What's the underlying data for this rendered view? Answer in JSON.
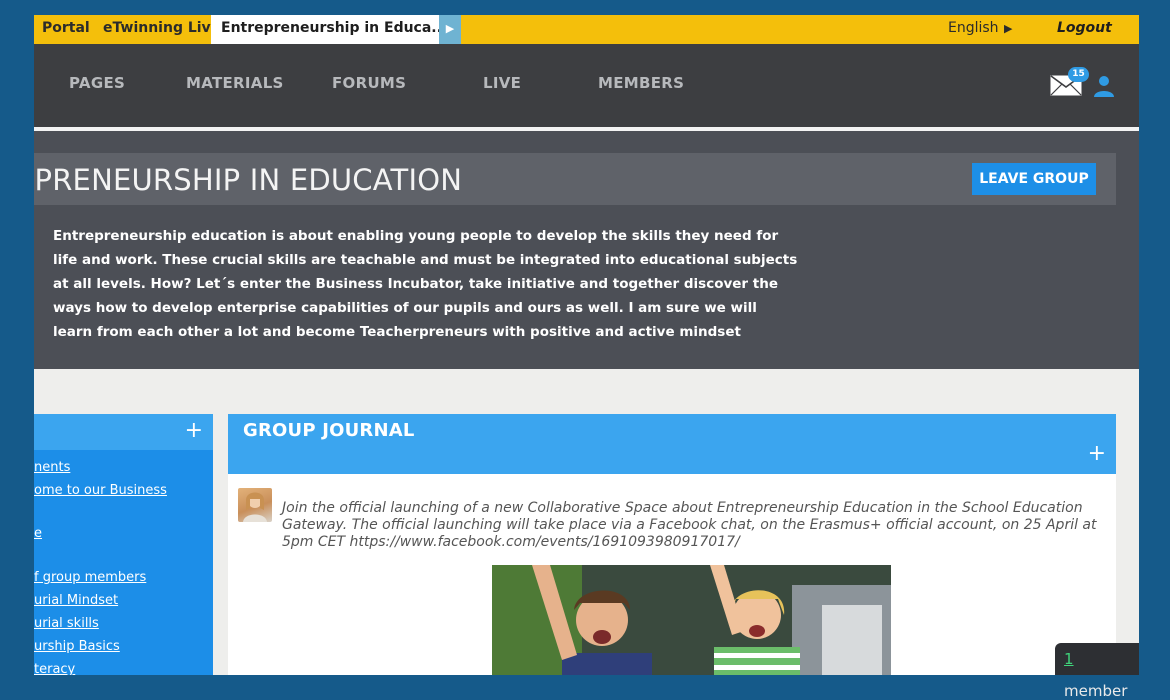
{
  "topbar": {
    "portal": "Portal",
    "etwinning_live": "eTwinning Live",
    "active_tab": "Entrepreneurship in Educa...",
    "language": "English",
    "logout": "Logout"
  },
  "nav": {
    "items": [
      "PAGES",
      "MATERIALS",
      "FORUMS",
      "LIVE",
      "MEMBERS"
    ],
    "mail_badge": "15"
  },
  "header": {
    "title": "EPRENEURSHIP IN EDUCATION",
    "leave_button": "LEAVE GROUP",
    "description": "Entrepreneurship education is about enabling young people to develop the skills they need for life and work. These crucial skills are teachable and must be integrated into educational subjects at all levels. How? Let´s enter the Business Incubator, take initiative and together discover the ways how to develop enterprise capabilities of our pupils and ours as well. I am sure we will learn from each other a lot and become Teacherpreneurs with positive and active mindset"
  },
  "left_panel": {
    "links": [
      "nents",
      "ome to our Business",
      "e",
      "f group members",
      "urial Mindset",
      "urial skills",
      "urship Basics",
      "teracy"
    ]
  },
  "journal": {
    "title": "GROUP JOURNAL",
    "post_text": "Join the official launching of a new Collaborative Space about Entrepreneurship Education in the School Education Gateway. The official launching will take place via a Facebook chat, on the Erasmus+ official account, on 25 April at 5pm CET https://www.facebook.com/events/1691093980917017/"
  },
  "member_pill": {
    "count": "1",
    "label": "member"
  },
  "colors": {
    "topbar": "#f4bf0b",
    "nav": "#3d3e41",
    "accent_blue": "#1d8fe7",
    "header_band": "#4c4f56"
  }
}
